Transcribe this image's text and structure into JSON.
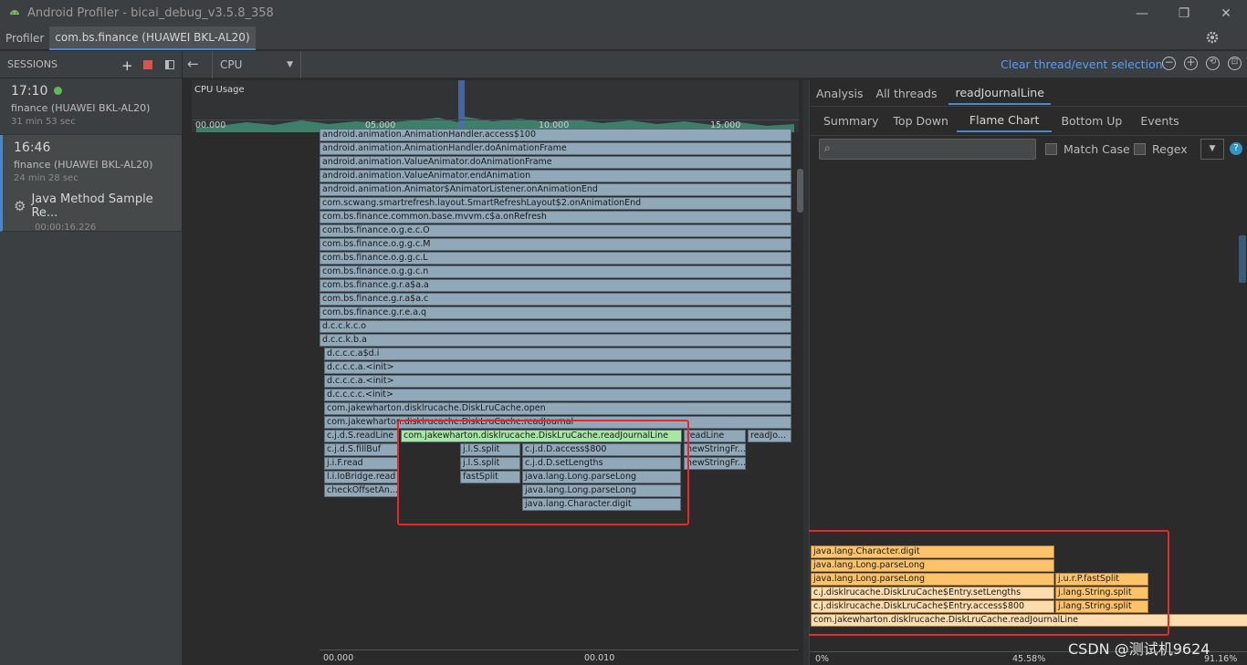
{
  "window": {
    "title": "Android Profiler - bicai_debug_v3.5.8_358"
  },
  "tabs": [
    "Profiler",
    "com.bs.finance (HUAWEI BKL-AL20)"
  ],
  "sessions": {
    "header": "SESSIONS",
    "items": [
      {
        "time": "17:10",
        "device": "finance (HUAWEI BKL-AL20)",
        "duration": "31 min 53 sec"
      },
      {
        "time": "16:46",
        "device": "finance (HUAWEI BKL-AL20)",
        "duration": "24 min 28 sec"
      }
    ],
    "recording": {
      "label": "Java Method Sample Re...",
      "duration": "00:00:16.226"
    }
  },
  "toolbar": {
    "profiler": "CPU",
    "clear_label": "Clear thread/event selection"
  },
  "cpu_usage": {
    "label": "CPU Usage",
    "ticks": [
      "00.000",
      "05.000",
      "10.000",
      "15.000"
    ]
  },
  "timeline_ticks": [
    "00.000",
    "00.010"
  ],
  "left_frames": [
    "android.animation.AnimationHandler.access$100",
    "android.animation.AnimationHandler.doAnimationFrame",
    "android.animation.ValueAnimator.doAnimationFrame",
    "android.animation.ValueAnimator.endAnimation",
    "android.animation.Animator$AnimatorListener.onAnimationEnd",
    "com.scwang.smartrefresh.layout.SmartRefreshLayout$2.onAnimationEnd",
    "com.bs.finance.common.base.mvvm.c$a.onRefresh",
    "com.bs.finance.o.g.e.c.O",
    "com.bs.finance.o.g.g.c.M",
    "com.bs.finance.o.g.g.c.L",
    "com.bs.finance.o.g.g.c.n",
    "com.bs.finance.g.r.a$a.a",
    "com.bs.finance.g.r.a$a.c",
    "com.bs.finance.g.r.e.a.q",
    "d.c.c.k.c.o",
    "d.c.c.k.b.a",
    "d.c.c.c.a$d.i",
    "d.c.c.c.a.<init>",
    "d.c.c.c.a.<init>",
    "d.c.c.c.c.<init>",
    "com.jakewharton.disklrucache.DiskLruCache.open",
    "com.jakewharton.disklrucache.DiskLruCache.readJournal"
  ],
  "left_branches": {
    "readLine": "c.j.d.S.readLine",
    "fillBuf": "c.j.d.S.fillBuf",
    "read": "j.i.F.read",
    "ioBridge": "l.i.IoBridge.read",
    "checkOffset": "checkOffsetAn...",
    "readJournalLine": "com.jakewharton.disklrucache.DiskLruCache.readJournalLine",
    "split1": "j.l.S.split",
    "split2": "j.l.S.split",
    "fastSplit": "fastSplit",
    "access800": "c.j.d.D.access$800",
    "setLengths": "c.j.d.D.setLengths",
    "parseLong1": "java.lang.Long.parseLong",
    "parseLong2": "java.lang.Long.parseLong",
    "charDigit": "java.lang.Character.digit",
    "readLine2": "readLine",
    "newString1": "newStringFr...",
    "newString2": "newStringFr...",
    "readJo": "readJo..."
  },
  "right": {
    "top_tabs": [
      "Analysis",
      "All threads",
      "readJournalLine"
    ],
    "sub_tabs": [
      "Summary",
      "Top Down",
      "Flame Chart",
      "Bottom Up",
      "Events"
    ],
    "match_case": "Match Case",
    "regex": "Regex",
    "frames": {
      "charDigit": "java.lang.Character.digit",
      "parseLong1": "java.lang.Long.parseLong",
      "parseLong2": "java.lang.Long.parseLong",
      "setLengths": "c.j.disklrucache.DiskLruCache$Entry.setLengths",
      "access800": "c.j.disklrucache.DiskLruCache$Entry.access$800",
      "readJournalLine": "com.jakewharton.disklrucache.DiskLruCache.readJournalLine",
      "fastSplit": "j.u.r.P.fastSplit",
      "split1": "j.lang.String.split",
      "split2": "j.lang.String.split"
    },
    "axis": [
      "0%",
      "45.58%",
      "91.16%"
    ]
  },
  "watermark": "CSDN @测试机9624"
}
